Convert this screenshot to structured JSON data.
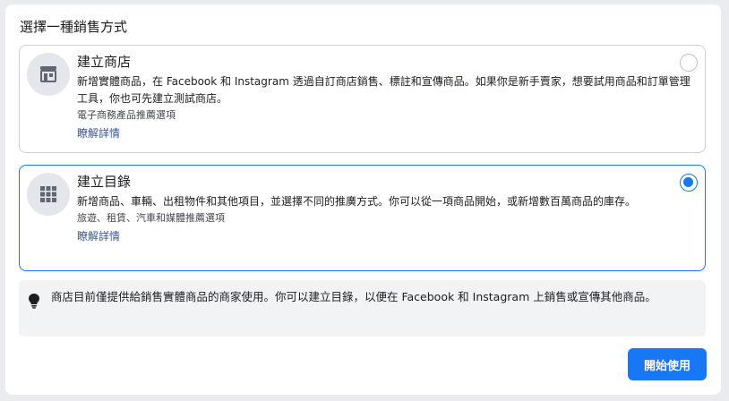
{
  "heading": "選擇一種銷售方式",
  "options": [
    {
      "title": "建立商店",
      "description": "新增實體商品，在 Facebook 和 Instagram 透過自訂商店銷售、標註和宣傳商品。如果你是新手賣家，想要試用商品和訂單管理工具，你也可先建立測試商店。",
      "subtitle": "電子商務產品推薦選項",
      "link": "瞭解詳情",
      "icon": "shop-icon",
      "selected": false
    },
    {
      "title": "建立目錄",
      "description": "新增商品、車輛、出租物件和其他項目，並選擇不同的推廣方式。你可以從一項商品開始，或新增數百萬商品的庫存。",
      "subtitle": "旅遊、租賃、汽車和媒體推薦選項",
      "link": "瞭解詳情",
      "icon": "grid-icon",
      "selected": true
    }
  ],
  "notice": {
    "icon": "lightbulb-icon",
    "text": "商店目前僅提供給銷售實體商品的商家使用。你可以建立目錄，以便在 Facebook 和 Instagram 上銷售或宣傳其他商品。"
  },
  "start_button": "開始使用",
  "colors": {
    "accent": "#1877f2",
    "link": "#385898",
    "icon_bg": "#e4e6eb",
    "notice_bg": "#f2f3f5"
  }
}
